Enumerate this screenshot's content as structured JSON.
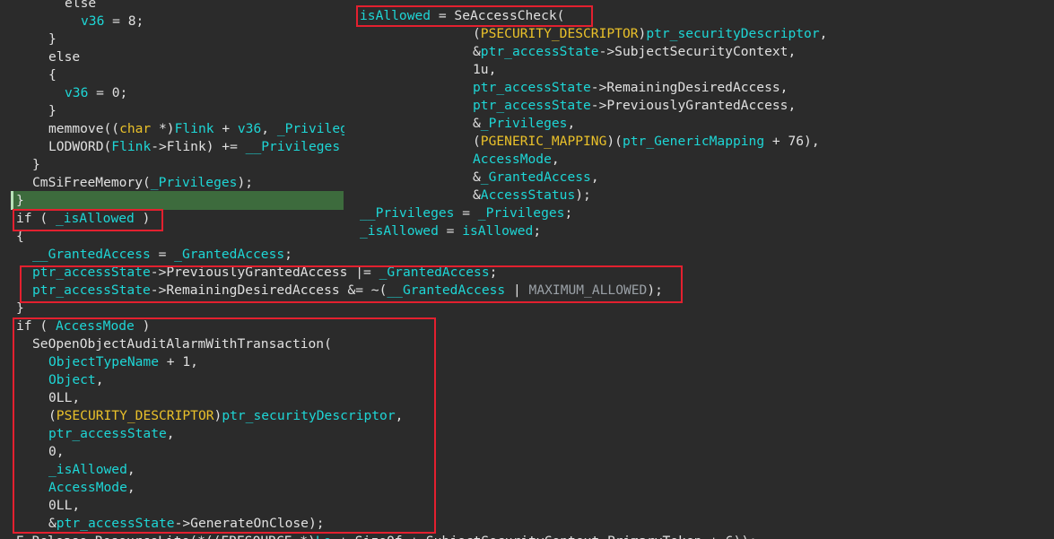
{
  "left_code": [
    [
      {
        "c": "p",
        "t": "else"
      }
    ],
    [
      {
        "c": "v",
        "t": "v36"
      },
      {
        "c": "p",
        "t": " = 8;"
      }
    ],
    [
      {
        "c": "p",
        "t": "}"
      }
    ],
    [
      {
        "c": "p",
        "t": "else"
      }
    ],
    [
      {
        "c": "p",
        "t": "{"
      }
    ],
    [
      {
        "c": "v",
        "t": "v36"
      },
      {
        "c": "p",
        "t": " = 0;"
      }
    ],
    [
      {
        "c": "p",
        "t": "}"
      }
    ],
    [
      {
        "c": "p",
        "t": "memmove(("
      },
      {
        "c": "t",
        "t": "char"
      },
      {
        "c": "p",
        "t": " *)"
      },
      {
        "c": "v",
        "t": "Flink"
      },
      {
        "c": "p",
        "t": " + "
      },
      {
        "c": "v",
        "t": "v36"
      },
      {
        "c": "p",
        "t": ", "
      },
      {
        "c": "v",
        "t": "_Privileges"
      }
    ],
    [
      {
        "c": "p",
        "t": "LODWORD("
      },
      {
        "c": "v",
        "t": "Flink"
      },
      {
        "c": "p",
        "t": "->Flink) += "
      },
      {
        "c": "v",
        "t": "__Privileges"
      }
    ],
    [
      {
        "c": "p",
        "t": "}"
      }
    ],
    [
      {
        "c": "p",
        "t": "CmSiFreeMemory("
      },
      {
        "c": "v",
        "t": "_Privileges"
      },
      {
        "c": "p",
        "t": ");"
      }
    ],
    [
      {
        "c": "p",
        "t": "}"
      }
    ],
    [
      {
        "c": "p",
        "t": "if ( "
      },
      {
        "c": "v",
        "t": "_isAllowed"
      },
      {
        "c": "p",
        "t": " )"
      }
    ],
    [
      {
        "c": "p",
        "t": "{"
      }
    ],
    [
      {
        "c": "v",
        "t": "__GrantedAccess"
      },
      {
        "c": "p",
        "t": " = "
      },
      {
        "c": "v",
        "t": "_GrantedAccess"
      },
      {
        "c": "p",
        "t": ";"
      }
    ],
    [
      {
        "c": "v",
        "t": "ptr_accessState"
      },
      {
        "c": "p",
        "t": "->PreviouslyGrantedAccess |= "
      },
      {
        "c": "v",
        "t": "_GrantedAccess"
      },
      {
        "c": "p",
        "t": ";"
      }
    ],
    [
      {
        "c": "v",
        "t": "ptr_accessState"
      },
      {
        "c": "p",
        "t": "->RemainingDesiredAccess &= ~("
      },
      {
        "c": "v",
        "t": "__GrantedAccess"
      },
      {
        "c": "p",
        "t": " | "
      },
      {
        "c": "g",
        "t": "MAXIMUM_ALLOWED"
      },
      {
        "c": "p",
        "t": ");"
      }
    ],
    [
      {
        "c": "p",
        "t": "}"
      }
    ],
    [
      {
        "c": "p",
        "t": "if ( "
      },
      {
        "c": "v",
        "t": "AccessMode"
      },
      {
        "c": "p",
        "t": " )"
      }
    ],
    [
      {
        "c": "p",
        "t": "SeOpenObjectAuditAlarmWithTransaction("
      }
    ],
    [
      {
        "c": "v",
        "t": "ObjectTypeName"
      },
      {
        "c": "p",
        "t": " + 1,"
      }
    ],
    [
      {
        "c": "v",
        "t": "Object"
      },
      {
        "c": "p",
        "t": ","
      }
    ],
    [
      {
        "c": "p",
        "t": "0LL,"
      }
    ],
    [
      {
        "c": "p",
        "t": "("
      },
      {
        "c": "t",
        "t": "PSECURITY_DESCRIPTOR"
      },
      {
        "c": "p",
        "t": ")"
      },
      {
        "c": "v",
        "t": "ptr_securityDescriptor"
      },
      {
        "c": "p",
        "t": ","
      }
    ],
    [
      {
        "c": "v",
        "t": "ptr_accessState"
      },
      {
        "c": "p",
        "t": ","
      }
    ],
    [
      {
        "c": "p",
        "t": "0,"
      }
    ],
    [
      {
        "c": "v",
        "t": "_isAllowed"
      },
      {
        "c": "p",
        "t": ","
      }
    ],
    [
      {
        "c": "v",
        "t": "AccessMode"
      },
      {
        "c": "p",
        "t": ","
      }
    ],
    [
      {
        "c": "p",
        "t": "0LL,"
      }
    ],
    [
      {
        "c": "p",
        "t": "&"
      },
      {
        "c": "v",
        "t": "ptr_accessState"
      },
      {
        "c": "p",
        "t": "->GenerateOnClose);"
      }
    ],
    [
      {
        "c": "p",
        "t": "E_Release_ResourceLite(*((ERESOURCE *)"
      },
      {
        "c": "v",
        "t": "Lo"
      },
      {
        "c": "p",
        "t": " + SizeOf + SubjectSecurityContext.PrimaryToken + 6));"
      }
    ]
  ],
  "right_code": [
    [
      {
        "c": "v",
        "t": "isAllowed"
      },
      {
        "c": "p",
        "t": " = SeAccessCheck("
      }
    ],
    [
      {
        "c": "p",
        "t": "("
      },
      {
        "c": "t",
        "t": "PSECURITY_DESCRIPTOR"
      },
      {
        "c": "p",
        "t": ")"
      },
      {
        "c": "v",
        "t": "ptr_securityDescriptor"
      },
      {
        "c": "p",
        "t": ","
      }
    ],
    [
      {
        "c": "p",
        "t": "&"
      },
      {
        "c": "v",
        "t": "ptr_accessState"
      },
      {
        "c": "p",
        "t": "->SubjectSecurityContext,"
      }
    ],
    [
      {
        "c": "p",
        "t": "1u,"
      }
    ],
    [
      {
        "c": "v",
        "t": "ptr_accessState"
      },
      {
        "c": "p",
        "t": "->RemainingDesiredAccess,"
      }
    ],
    [
      {
        "c": "v",
        "t": "ptr_accessState"
      },
      {
        "c": "p",
        "t": "->PreviouslyGrantedAccess,"
      }
    ],
    [
      {
        "c": "p",
        "t": "&"
      },
      {
        "c": "v",
        "t": "_Privileges"
      },
      {
        "c": "p",
        "t": ","
      }
    ],
    [
      {
        "c": "p",
        "t": "("
      },
      {
        "c": "t",
        "t": "PGENERIC_MAPPING"
      },
      {
        "c": "p",
        "t": ")("
      },
      {
        "c": "v",
        "t": "ptr_GenericMapping"
      },
      {
        "c": "p",
        "t": " + 76),"
      }
    ],
    [
      {
        "c": "v",
        "t": "AccessMode"
      },
      {
        "c": "p",
        "t": ","
      }
    ],
    [
      {
        "c": "p",
        "t": "&"
      },
      {
        "c": "v",
        "t": "_GrantedAccess"
      },
      {
        "c": "p",
        "t": ","
      }
    ],
    [
      {
        "c": "p",
        "t": "&"
      },
      {
        "c": "v",
        "t": "AccessStatus"
      },
      {
        "c": "p",
        "t": ");"
      }
    ],
    [
      {
        "c": "v",
        "t": "__Privileges"
      },
      {
        "c": "p",
        "t": " = "
      },
      {
        "c": "v",
        "t": "_Privileges"
      },
      {
        "c": "p",
        "t": ";"
      }
    ],
    [
      {
        "c": "v",
        "t": "_isAllowed"
      },
      {
        "c": "p",
        "t": " = "
      },
      {
        "c": "v",
        "t": "isAllowed"
      },
      {
        "c": "p",
        "t": ";"
      }
    ]
  ]
}
